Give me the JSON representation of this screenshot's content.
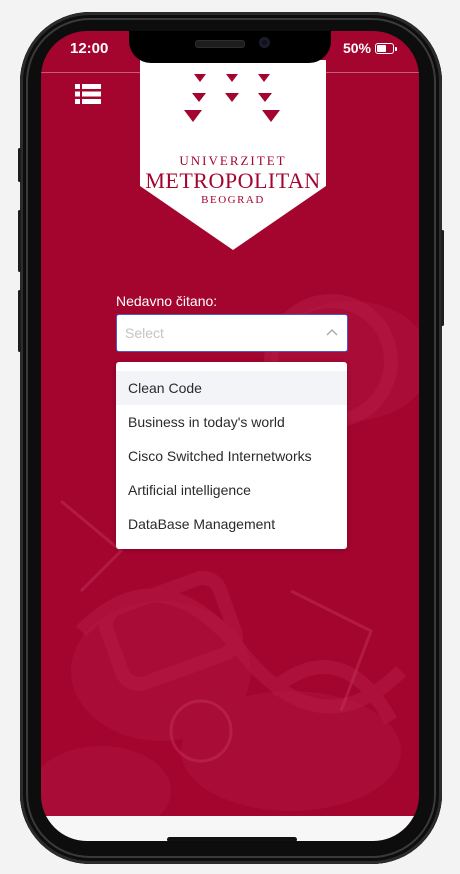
{
  "status_bar": {
    "time": "12:00",
    "battery": "50%"
  },
  "logo": {
    "line1": "UNIVERZITET",
    "line2": "METROPOLITAN",
    "line3": "BEOGRAD"
  },
  "recent": {
    "label": "Nedavno čitano:",
    "placeholder": "Select",
    "options": [
      "Clean Code",
      "Business in today's world",
      "Cisco Switched Internetworks",
      "Artificial intelligence",
      "DataBase Management"
    ]
  },
  "colors": {
    "brand": "#a3052f",
    "focus_border": "#4a5cc7"
  },
  "icons": {
    "menu": "list-icon",
    "chevron": "chevron-up-icon",
    "battery": "battery-icon"
  }
}
